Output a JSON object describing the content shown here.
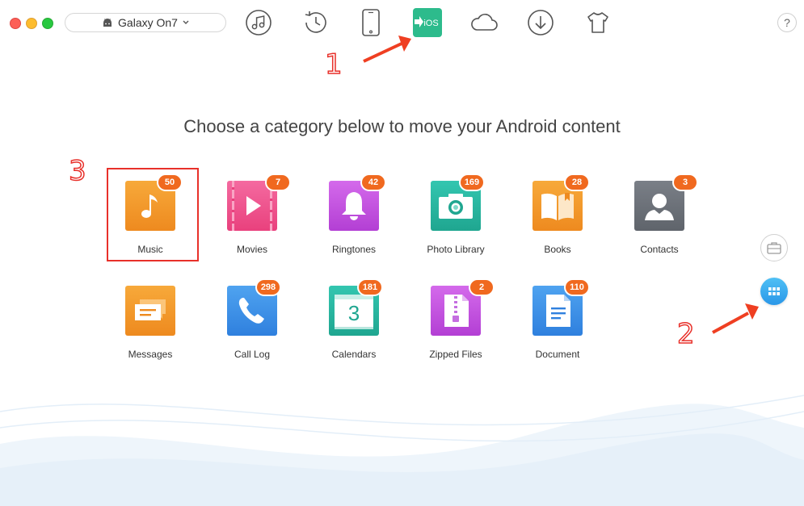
{
  "device": {
    "name": "Galaxy On7",
    "icon": "android-icon",
    "chevron": "chevron-down-icon"
  },
  "toolbar": [
    {
      "name": "music-manager",
      "icon": "music-note-icon"
    },
    {
      "name": "history",
      "icon": "history-clock-icon"
    },
    {
      "name": "device-manager",
      "icon": "phone-icon"
    },
    {
      "name": "android-to-ios",
      "icon": "ios-mover-icon",
      "label": "iOS",
      "active": true
    },
    {
      "name": "icloud",
      "icon": "cloud-icon"
    },
    {
      "name": "downloader",
      "icon": "download-icon"
    },
    {
      "name": "toolkit",
      "icon": "tshirt-icon"
    }
  ],
  "help_label": "?",
  "heading": "Choose a category below to move your Android content",
  "categories": [
    {
      "label": "Music",
      "count": "50",
      "icon": "music-icon",
      "color": "#f29a2c",
      "selected": true
    },
    {
      "label": "Movies",
      "count": "7",
      "icon": "movies-icon",
      "color": "#ee4e8a"
    },
    {
      "label": "Ringtones",
      "count": "42",
      "icon": "bell-icon",
      "color": "#c54fe0"
    },
    {
      "label": "Photo Library",
      "count": "169",
      "icon": "camera-icon",
      "color": "#27b5a0"
    },
    {
      "label": "Books",
      "count": "28",
      "icon": "book-icon",
      "color": "#f29a2c"
    },
    {
      "label": "Contacts",
      "count": "3",
      "icon": "contact-icon",
      "color": "#6b7078"
    },
    {
      "label": "Messages",
      "count": "",
      "icon": "message-icon",
      "color": "#f29a2c"
    },
    {
      "label": "Call Log",
      "count": "298",
      "icon": "phone-call-icon",
      "color": "#3d8ee8"
    },
    {
      "label": "Calendars",
      "count": "181",
      "icon": "calendar-icon",
      "color": "#27b5a0",
      "day": "3"
    },
    {
      "label": "Zipped Files",
      "count": "2",
      "icon": "zip-icon",
      "color": "#c54fe0"
    },
    {
      "label": "Document",
      "count": "110",
      "icon": "document-icon",
      "color": "#3d8ee8"
    }
  ],
  "side_buttons": [
    {
      "name": "briefcase",
      "icon": "briefcase-icon"
    },
    {
      "name": "category-view",
      "icon": "grid-icon",
      "active": true
    }
  ],
  "annotations": [
    {
      "number": "1"
    },
    {
      "number": "2"
    },
    {
      "number": "3"
    }
  ]
}
